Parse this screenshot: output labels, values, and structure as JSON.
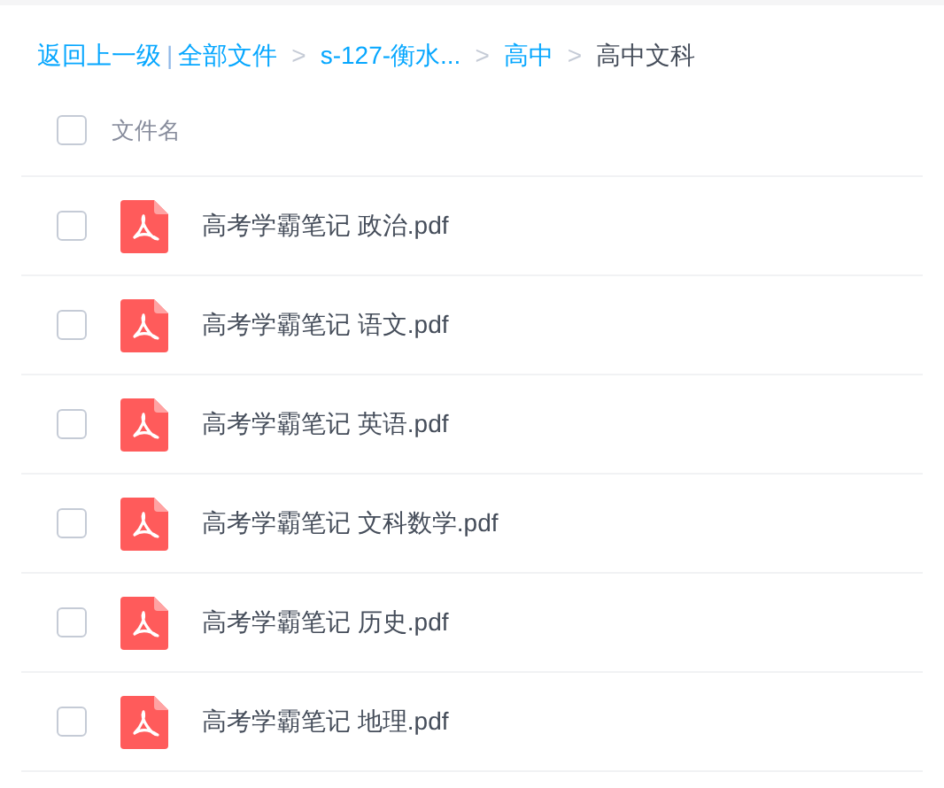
{
  "breadcrumb": {
    "back": "返回上一级",
    "divider": "|",
    "crumbs": [
      {
        "label": "全部文件",
        "current": false
      },
      {
        "label": "s-127-衡水...",
        "current": false
      },
      {
        "label": "高中",
        "current": false
      },
      {
        "label": "高中文科",
        "current": true
      }
    ],
    "separator": ">"
  },
  "table": {
    "header": {
      "label": "文件名",
      "checked": false
    },
    "rows": [
      {
        "name": "高考学霸笔记 政治.pdf",
        "checked": false
      },
      {
        "name": "高考学霸笔记 语文.pdf",
        "checked": false
      },
      {
        "name": "高考学霸笔记 英语.pdf",
        "checked": false
      },
      {
        "name": "高考学霸笔记 文科数学.pdf",
        "checked": false
      },
      {
        "name": "高考学霸笔记 历史.pdf",
        "checked": false
      },
      {
        "name": "高考学霸笔记 地理.pdf",
        "checked": false
      }
    ]
  }
}
